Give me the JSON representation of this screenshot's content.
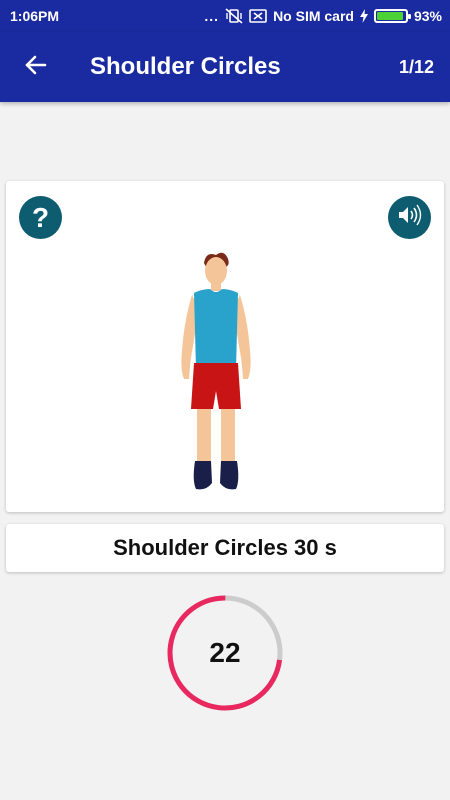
{
  "status_bar": {
    "time": "1:06PM",
    "dots": "...",
    "carrier": "No SIM card",
    "battery_percent": "93%",
    "battery_level": 0.93
  },
  "app_bar": {
    "title": "Shoulder Circles",
    "counter": "1/12"
  },
  "exercise": {
    "help_label": "?",
    "title": "Shoulder Circles 30 s"
  },
  "timer": {
    "value": "22",
    "progress": 0.27,
    "accent_color": "#e8285f",
    "track_color": "#cccccc"
  },
  "colors": {
    "primary": "#1a2aa0",
    "icon_button": "#0d5c70"
  },
  "icons": {
    "back": "arrow-left-icon",
    "help": "question-icon",
    "sound": "speaker-icon"
  }
}
